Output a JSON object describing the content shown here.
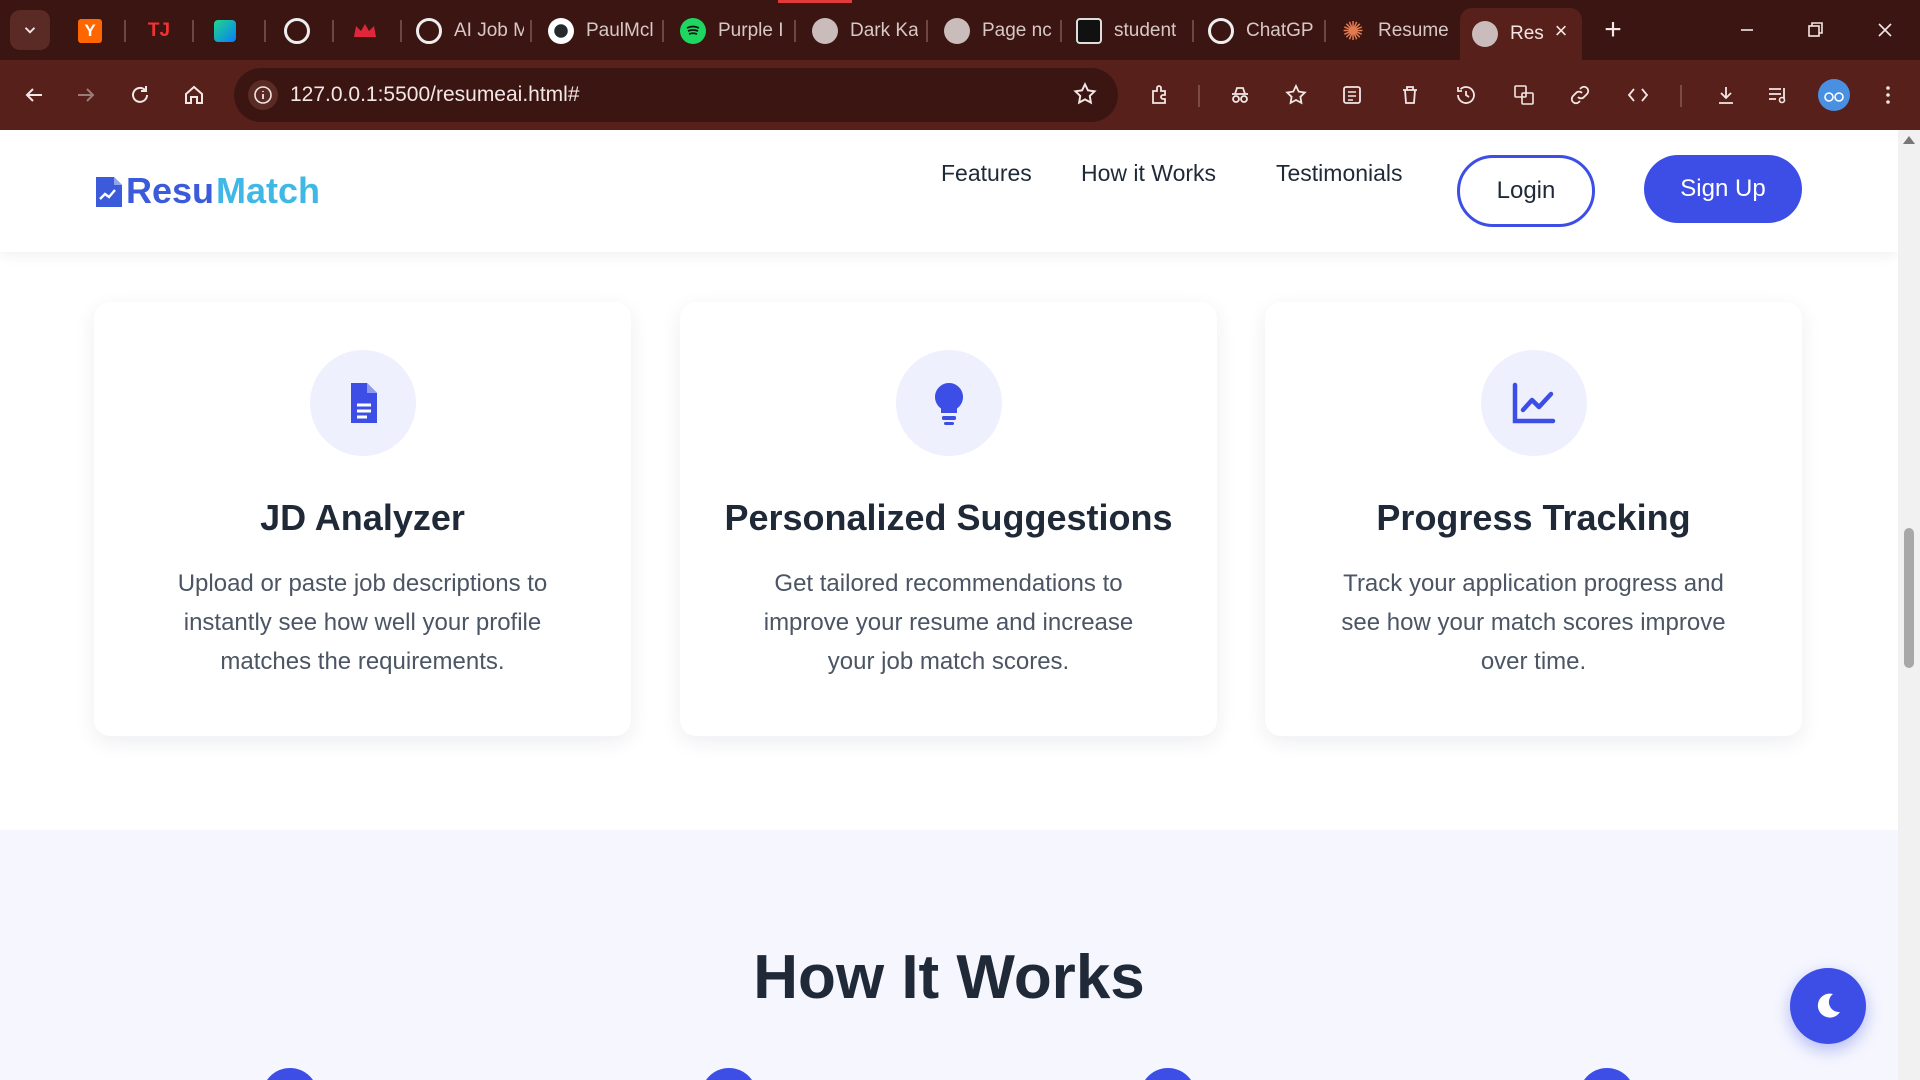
{
  "browser": {
    "tabs": [
      {
        "title": "",
        "icon": "y-combinator-icon"
      },
      {
        "title": "",
        "icon": "tj-icon"
      },
      {
        "title": "",
        "icon": "pycharm-icon"
      },
      {
        "title": "",
        "icon": "chatgpt-icon"
      },
      {
        "title": "",
        "icon": "crown-icon"
      },
      {
        "title": "AI Job M",
        "icon": "chatgpt-icon"
      },
      {
        "title": "PaulMcl",
        "icon": "github-icon"
      },
      {
        "title": "Purple I",
        "icon": "spotify-icon"
      },
      {
        "title": "Dark Ka",
        "icon": "globe-icon"
      },
      {
        "title": "Page nc",
        "icon": "globe-icon"
      },
      {
        "title": "student",
        "icon": "student-icon"
      },
      {
        "title": "ChatGP",
        "icon": "chatgpt-icon"
      },
      {
        "title": "Resume",
        "icon": "claude-icon"
      },
      {
        "title": "Res",
        "icon": "globe-icon",
        "active": true
      }
    ],
    "url": "127.0.0.1:5500/resumeai.html#"
  },
  "site": {
    "logo": {
      "part1": "Resu",
      "part2": "Match"
    },
    "nav": {
      "features": "Features",
      "how": "How it Works",
      "testimonials": "Testimonials"
    },
    "login_label": "Login",
    "signup_label": "Sign Up"
  },
  "features": [
    {
      "title": "JD Analyzer",
      "text": "Upload or paste job descriptions to instantly see how well your profile matches the requirements.",
      "icon": "document-icon"
    },
    {
      "title": "Personalized Suggestions",
      "text": "Get tailored recommendations to improve your resume and increase your job match scores.",
      "icon": "lightbulb-icon"
    },
    {
      "title": "Progress Tracking",
      "text": "Track your application progress and see how your match scores improve over time.",
      "icon": "chart-line-icon"
    }
  ],
  "how_it_works": {
    "title": "How It Works"
  },
  "colors": {
    "accent": "#3d4ee6",
    "logo_blue": "#3b5bdb",
    "logo_cyan": "#3fb8e6",
    "chrome_bg": "#57201b"
  }
}
